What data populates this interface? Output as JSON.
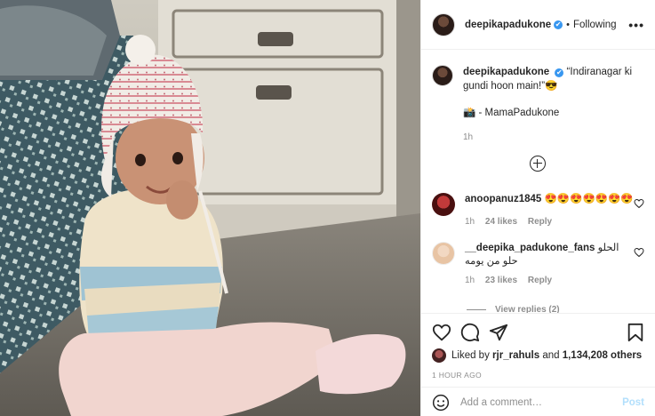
{
  "header": {
    "username": "deepikapadukone",
    "verified_mark": "✔",
    "separator": "•",
    "follow_status": "Following",
    "more": "•••"
  },
  "caption": {
    "username": "deepikapadukone",
    "text": "“Indiranagar ki gundi hoon main!”😎",
    "line2": "📸 - MamaPadukone",
    "time": "1h"
  },
  "comments": [
    {
      "username": "anoopanuz1845",
      "text": "😍😍😍😍😍😍😍",
      "time": "1h",
      "likes": "24 likes",
      "reply": "Reply"
    },
    {
      "username": "__deepika_padukone_fans",
      "text": "الحلو",
      "text2": "حلو من يومه",
      "time": "1h",
      "likes": "23 likes",
      "reply": "Reply"
    }
  ],
  "view_replies": "View replies (2)",
  "likes": {
    "prefix": "Liked by",
    "user": "rjr_rahuls",
    "middle": "and",
    "count": "1,134,208 others"
  },
  "timestamp": "1 HOUR AGO",
  "add_comment": {
    "placeholder": "Add a comment…",
    "post_label": "Post"
  },
  "colors": {
    "link_blue": "#3897f0",
    "post_disabled": "#b2dffc",
    "secondary_text": "#8e8e8e"
  }
}
